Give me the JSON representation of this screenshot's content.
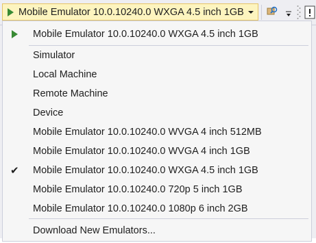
{
  "toolbar": {
    "target_label": "Mobile Emulator 10.0.10240.0 WXGA 4.5 inch 1GB",
    "play_icon": "play-icon",
    "caret_icon": "chevron-down-icon",
    "search_icon": "find-in-files-icon",
    "overflow_icon": "toolbar-overflow-icon",
    "accent_color": "#388a34"
  },
  "menu": {
    "default_item": "Mobile Emulator 10.0.10240.0 WXGA 4.5 inch 1GB",
    "items": [
      {
        "label": "Simulator",
        "checked": false
      },
      {
        "label": "Local Machine",
        "checked": false
      },
      {
        "label": "Remote Machine",
        "checked": false
      },
      {
        "label": "Device",
        "checked": false
      },
      {
        "label": "Mobile Emulator 10.0.10240.0 WVGA 4 inch 512MB",
        "checked": false
      },
      {
        "label": "Mobile Emulator 10.0.10240.0 WVGA 4 inch 1GB",
        "checked": false
      },
      {
        "label": "Mobile Emulator 10.0.10240.0 WXGA 4.5 inch 1GB",
        "checked": true
      },
      {
        "label": "Mobile Emulator 10.0.10240.0 720p 5 inch 1GB",
        "checked": false
      },
      {
        "label": "Mobile Emulator 10.0.10240.0 1080p 6 inch 2GB",
        "checked": false
      }
    ],
    "check_glyph": "✔",
    "download_label": "Download New Emulators..."
  }
}
